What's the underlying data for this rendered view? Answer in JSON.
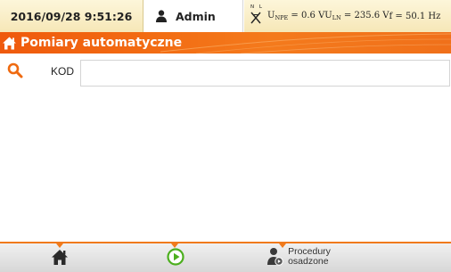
{
  "status_bar": {
    "datetime": "2016/09/28 9:51:26",
    "user": "Admin",
    "plug_label": "N L",
    "readings": {
      "unpe_prefix": "U",
      "unpe_sub": "NPE",
      "unpe_value": " = 0.6 V ",
      "uln_prefix": "U",
      "uln_sub": "LN",
      "uln_value": " = 235.6 V ",
      "freq": "f = 50.1 Hz"
    }
  },
  "title_bar": {
    "title": "Pomiary automatyczne"
  },
  "search": {
    "label": "KOD",
    "value": "",
    "placeholder": ""
  },
  "bottom_bar": {
    "procedures_line1": "Procedury",
    "procedures_line2": "osadzone"
  },
  "colors": {
    "accent": "#f07a1c",
    "title_bg": "#ef5a0d",
    "status_bg": "#f8edc6",
    "start_green": "#4caf1e"
  },
  "icons": [
    "home-icon",
    "user-icon",
    "plug-icon",
    "search-icon",
    "play-icon",
    "procedures-icon"
  ]
}
